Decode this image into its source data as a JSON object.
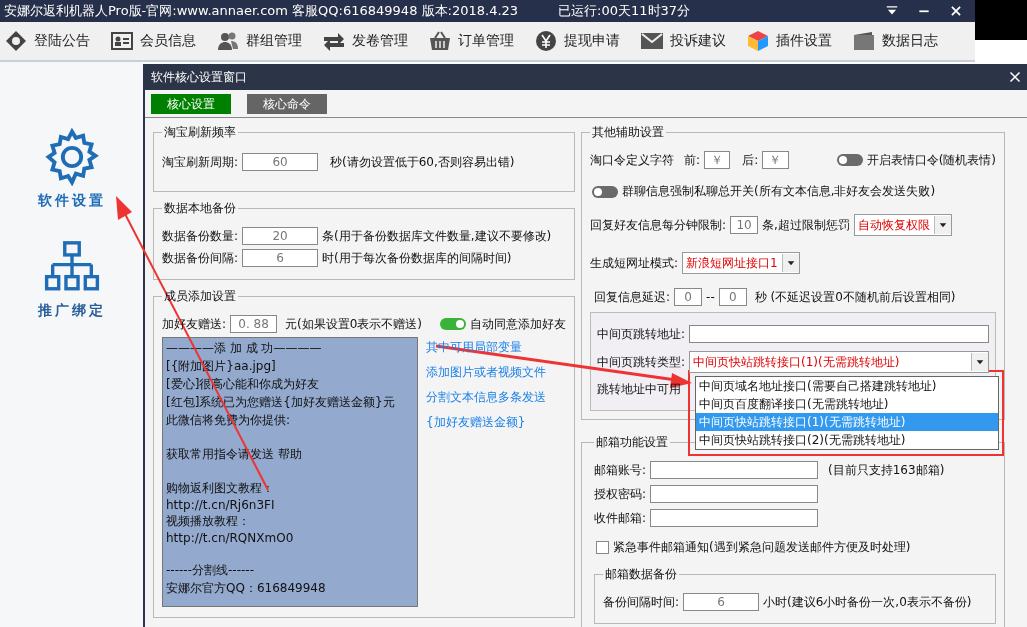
{
  "window": {
    "title": "安娜尔返利机器人Pro版-官网:www.annaer.com 客服QQ:616849948  版本:2018.4.23",
    "runtime": "已运行:00天11时37分"
  },
  "toolbar": [
    {
      "label": "登陆公告"
    },
    {
      "label": "会员信息"
    },
    {
      "label": "群组管理"
    },
    {
      "label": "发卷管理"
    },
    {
      "label": "订单管理"
    },
    {
      "label": "提现申请"
    },
    {
      "label": "投诉建议"
    },
    {
      "label": "插件设置"
    },
    {
      "label": "数据日志"
    }
  ],
  "sidebar": [
    {
      "label": "软件设置",
      "selected": true
    },
    {
      "label": "推广绑定",
      "selected": false
    }
  ],
  "dialog": {
    "title": "软件核心设置窗口",
    "tabs": [
      {
        "label": "核心设置",
        "selected": true
      },
      {
        "label": "核心命令",
        "selected": false
      }
    ],
    "taobao_refresh": {
      "title": "淘宝刷新频率",
      "label": "淘宝刷新周期:",
      "value": "60",
      "note": "秒(请勿设置低于60,否则容易出错)"
    },
    "local_backup": {
      "title": "数据本地备份",
      "rows": [
        {
          "label": "数据备份数量:",
          "value": "20",
          "note": "条(用于备份数据库文件数量,建议不要修改)"
        },
        {
          "label": "数据备份间隔:",
          "value": "6",
          "note": "时(用于每次备份数据库的间隔时间)"
        }
      ]
    },
    "member_add": {
      "title": "成员添加设置",
      "gift_label": "加好友赠送:",
      "gift_value": "0. 88",
      "gift_note": "元(如果设置0表示不赠送)",
      "auto_accept": {
        "label": "自动同意添加好友",
        "on": true
      },
      "message_blocks": [
        [
          "————添 加 成 功————",
          "[{附加图片}aa.jpg]",
          "[爱心]很高心能和你成为好友",
          "[红包]系统已为您赠送{加好友赠送金额}元",
          "此微信将免费为你提供:"
        ],
        [
          "获取常用指令请发送  帮助"
        ],
        [
          "购物返利图文教程：",
          "http://t.cn/Rj6n3FI",
          "视频播放教程：",
          "http://t.cn/RQNXmO0"
        ],
        [
          "------分割线------",
          "安娜尔官方QQ：616849948"
        ]
      ],
      "links": [
        "其中可用局部变量",
        "添加图片或者视频文件",
        "分割文本信息多条发送",
        "{加好友赠送金额}"
      ]
    },
    "other": {
      "title": "其他辅助设置",
      "token_label": "淘口令定义字符",
      "before_label": "前:",
      "before_value": "￥",
      "after_label": "后:",
      "after_value": "￥",
      "emoji_toggle": {
        "label": "开启表情口令(随机表情)",
        "on": false
      },
      "private_toggle": {
        "label": "群聊信息强制私聊总开关(所有文本信息,非好友会发送失败)",
        "on": false
      },
      "reply_limit": {
        "label": "回复好友信息每分钟限制:",
        "value": "10",
        "note": "条,超过限制惩罚",
        "penalty": "自动恢复权限"
      },
      "short_url": {
        "label": "生成短网址模式:",
        "value": "新浪短网址接口1"
      },
      "delay": {
        "label": "回复信息延迟:",
        "min": "0",
        "separator": "--",
        "max": "0",
        "note": "秒 (不延迟设置0不随机前后设置相同)"
      },
      "redirect": {
        "address_label": "中间页跳转地址:",
        "type_label": "中间页跳转类型:",
        "type_value": "中间页快站跳转接口(1)(无需跳转地址)",
        "variables_label": "跳转地址中可用"
      }
    },
    "type_options": [
      {
        "label": "中间页域名地址接口(需要自己搭建跳转地址)",
        "selected": false
      },
      {
        "label": "中间页百度翻译接口(无需跳转地址)",
        "selected": false
      },
      {
        "label": "中间页快站跳转接口(1)(无需跳转地址)",
        "selected": true
      },
      {
        "label": "中间页快站跳转接口(2)(无需跳转地址)",
        "selected": false
      }
    ],
    "mail": {
      "title": "邮箱功能设置",
      "account_label": "邮箱账号:",
      "account_note": "(目前只支持163邮箱)",
      "password_label": "授权密码:",
      "inbox_label": "收件邮箱:",
      "urgent": {
        "label": "紧急事件邮箱通知(遇到紧急问题发送邮件方便及时处理)",
        "checked": false
      },
      "backup": {
        "title": "邮箱数据备份",
        "label": "备份间隔时间:",
        "value": "6",
        "note": "小时(建议6小时备份一次,0表示不备份)"
      }
    }
  }
}
